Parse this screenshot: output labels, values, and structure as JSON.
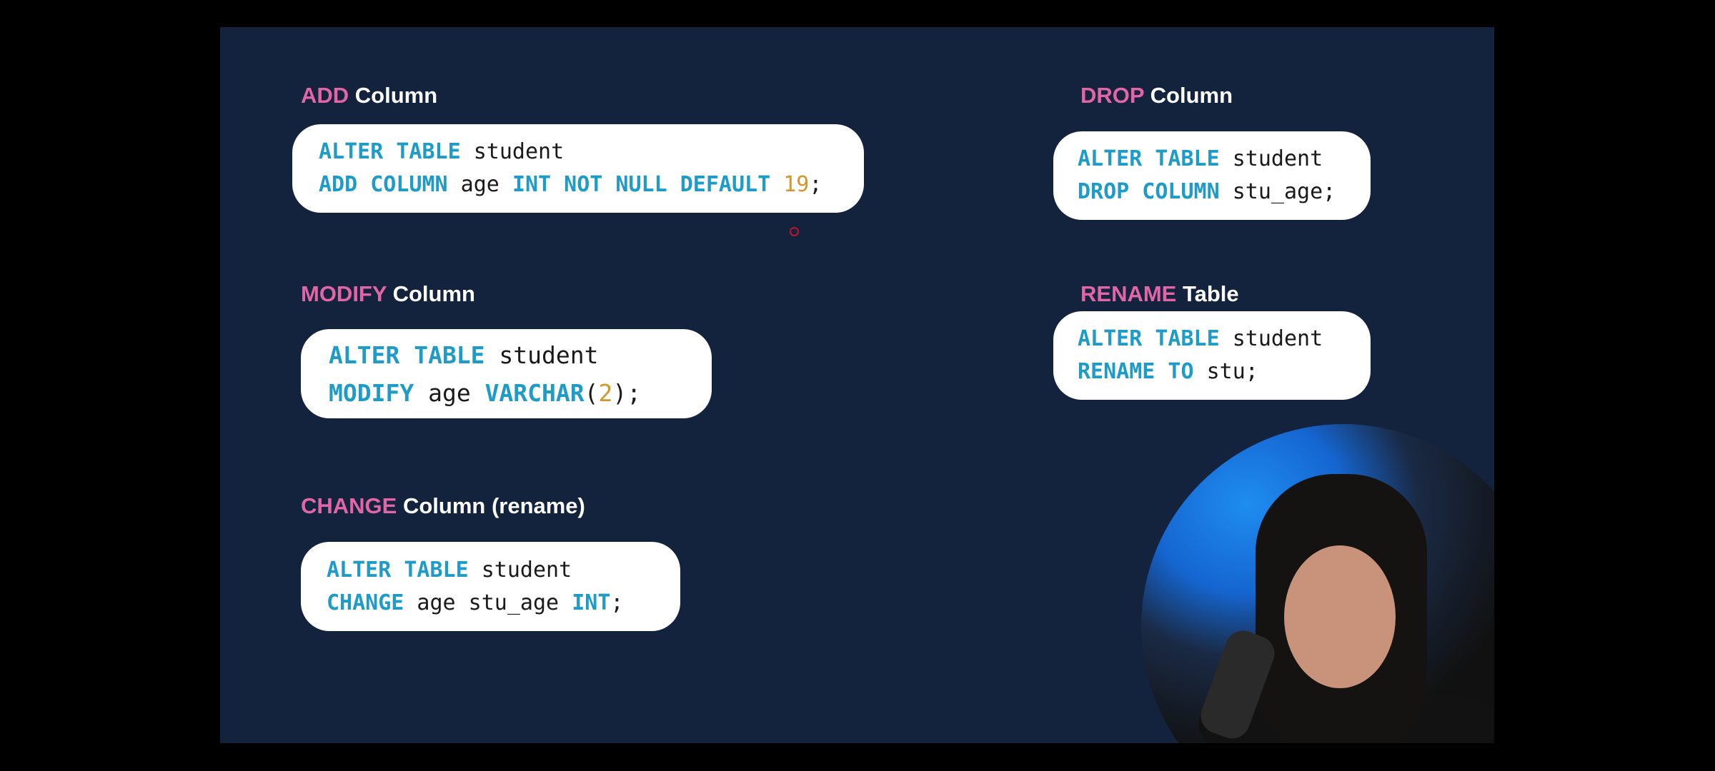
{
  "colors": {
    "background": "#13223d",
    "heading_keyword": "#e066a6",
    "sql_keyword": "#1f9bc7",
    "number": "#d4962c"
  },
  "sections": {
    "add": {
      "keyword": "ADD",
      "rest": " Column",
      "lines": [
        [
          {
            "t": "ALTER TABLE",
            "c": "k"
          },
          {
            "t": " student",
            "c": "t"
          }
        ],
        [
          {
            "t": "ADD COLUMN",
            "c": "k"
          },
          {
            "t": " age ",
            "c": "t"
          },
          {
            "t": "INT NOT NULL DEFAULT",
            "c": "k"
          },
          {
            "t": " ",
            "c": "t"
          },
          {
            "t": "19",
            "c": "n"
          },
          {
            "t": ";",
            "c": "t"
          }
        ]
      ]
    },
    "modify": {
      "keyword": "MODIFY",
      "rest": " Column",
      "lines": [
        [
          {
            "t": "ALTER TABLE",
            "c": "k"
          },
          {
            "t": " student",
            "c": "t"
          }
        ],
        [
          {
            "t": "MODIFY",
            "c": "k"
          },
          {
            "t": " age ",
            "c": "t"
          },
          {
            "t": "VARCHAR",
            "c": "k"
          },
          {
            "t": "(",
            "c": "t"
          },
          {
            "t": "2",
            "c": "n"
          },
          {
            "t": ");",
            "c": "t"
          }
        ]
      ]
    },
    "change": {
      "keyword": "CHANGE",
      "rest": " Column (rename)",
      "lines": [
        [
          {
            "t": "ALTER TABLE",
            "c": "k"
          },
          {
            "t": " student",
            "c": "t"
          }
        ],
        [
          {
            "t": "CHANGE",
            "c": "k"
          },
          {
            "t": " age stu_age ",
            "c": "t"
          },
          {
            "t": "INT",
            "c": "k"
          },
          {
            "t": ";",
            "c": "t"
          }
        ]
      ]
    },
    "drop": {
      "keyword": "DROP",
      "rest": " Column",
      "lines": [
        [
          {
            "t": "ALTER TABLE",
            "c": "k"
          },
          {
            "t": " student",
            "c": "t"
          }
        ],
        [
          {
            "t": "DROP COLUMN",
            "c": "k"
          },
          {
            "t": " stu_age;",
            "c": "t"
          }
        ]
      ]
    },
    "rename": {
      "keyword": "RENAME",
      "rest": " Table",
      "lines": [
        [
          {
            "t": "ALTER TABLE",
            "c": "k"
          },
          {
            "t": " student",
            "c": "t"
          }
        ],
        [
          {
            "t": "RENAME TO",
            "c": "k"
          },
          {
            "t": " stu;",
            "c": "t"
          }
        ]
      ]
    }
  }
}
